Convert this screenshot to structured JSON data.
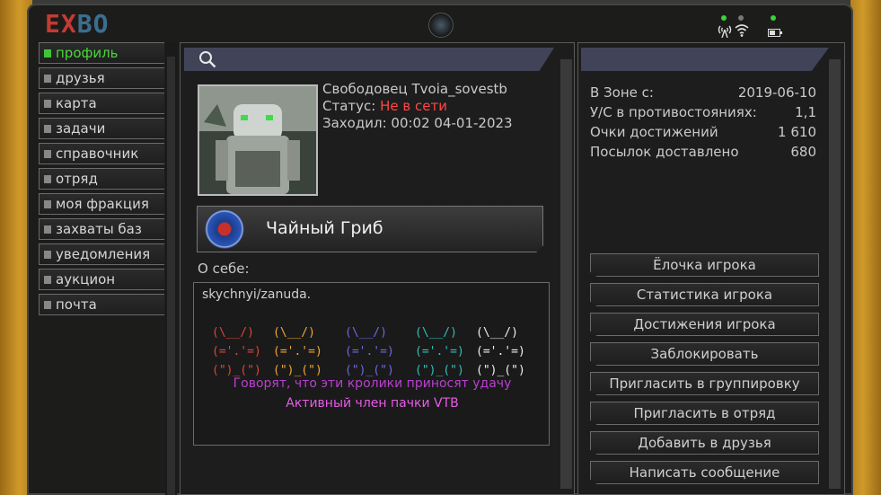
{
  "logo": {
    "part1": "EX",
    "part2": "BO"
  },
  "menu": [
    {
      "label": "профиль",
      "active": true
    },
    {
      "label": "друзья"
    },
    {
      "label": "карта"
    },
    {
      "label": "задачи"
    },
    {
      "label": "справочник"
    },
    {
      "label": "отряд"
    },
    {
      "label": "моя фракция"
    },
    {
      "label": "захваты баз"
    },
    {
      "label": "уведомления"
    },
    {
      "label": "аукцион"
    },
    {
      "label": "почта"
    }
  ],
  "profile": {
    "name_line": "Свободовец Tvoia_sovestb",
    "status_label": "Статус:",
    "status_value": "Не в сети",
    "last_seen_label": "Заходил:",
    "last_seen_value": "00:02 04-01-2023",
    "faction_name": "Чайный Гриб",
    "about_label": "О себе:",
    "about_text": "skychnyi/zanuda.",
    "bunnies": [
      {
        "art": "(\\__/)\n(='.'=)\n(\")_(\")",
        "color": "#e0453a"
      },
      {
        "art": "(\\__/)\n(='.'=)\n(\")_(\")",
        "color": "#f0a830"
      },
      {
        "art": "(\\__/)\n(='.'=)\n(\")_(\")",
        "color": "#6a6ae8"
      },
      {
        "art": "(\\__/)\n(='.'=)\n(\")_(\")",
        "color": "#2fc0b8"
      },
      {
        "art": "(\\__/)\n(='.'=)\n(\")_(\")",
        "color": "#f0f0f0"
      }
    ],
    "about_line1": "Говорят, что эти кролики приносят удачу",
    "about_line2": "Активный член пачки VTB"
  },
  "stats": [
    {
      "label": "В Зоне с:",
      "value": "2019-06-10"
    },
    {
      "label": "У/С в противостояниях:",
      "value": "1,1"
    },
    {
      "label": "Очки достижений",
      "value": "1 610"
    },
    {
      "label": "Посылок доставлено",
      "value": "680"
    }
  ],
  "actions": [
    "Ёлочка игрока",
    "Статистика игрока",
    "Достижения игрока",
    "Заблокировать",
    "Пригласить в группировку",
    "Пригласить в отряд",
    "Добавить в друзья",
    "Написать сообщение"
  ],
  "icons": {
    "search": "search-icon",
    "wifi": "wifi-icon",
    "antenna": "antenna-icon",
    "battery": "battery-icon"
  }
}
